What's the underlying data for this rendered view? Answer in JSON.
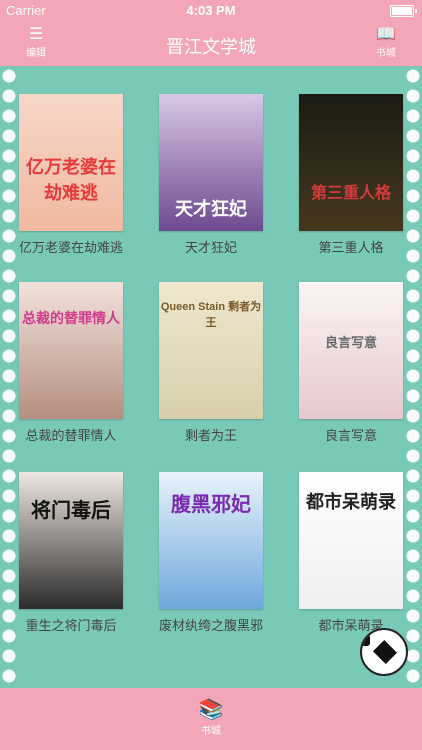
{
  "status_bar": {
    "carrier": "Carrier",
    "time": "4:03 PM"
  },
  "nav": {
    "title": "晋江文学城",
    "left_label": "编辑",
    "right_label": "书城"
  },
  "books": [
    {
      "title": "亿万老婆在劫难逃",
      "cover_text": "亿万老婆在劫难逃",
      "accent": "#f3c6b0"
    },
    {
      "title": "天才狂妃",
      "cover_text": "天才狂妃",
      "accent": "#7a4f9a"
    },
    {
      "title": "第三重人格",
      "cover_text": "第三重人格",
      "accent": "#2a2a1e"
    },
    {
      "title": "总裁的替罪情人",
      "cover_text": "总裁的替罪情人",
      "accent": "#c9a89a"
    },
    {
      "title": "剩者为王",
      "cover_text": "Queen Stain 剩者为王",
      "accent": "#e8e0c4"
    },
    {
      "title": "良言写意",
      "cover_text": "良言写意",
      "accent": "#f1e9e9"
    },
    {
      "title": "重生之将门毒后",
      "cover_text": "将门毒后",
      "accent": "#2b2b2b"
    },
    {
      "title": "废材纨绔之腹黑邪",
      "cover_text": "腹黑邪妃",
      "accent": "#7fb4e0"
    },
    {
      "title": "都市呆萌录",
      "cover_text": "都市呆萌录",
      "accent": "#f5f5f5"
    }
  ],
  "tabbar": {
    "label": "书城"
  },
  "icons": {
    "edit": "list-icon",
    "store": "book-icon",
    "tab": "books-icon",
    "ball": "soccer-ball-icon"
  }
}
